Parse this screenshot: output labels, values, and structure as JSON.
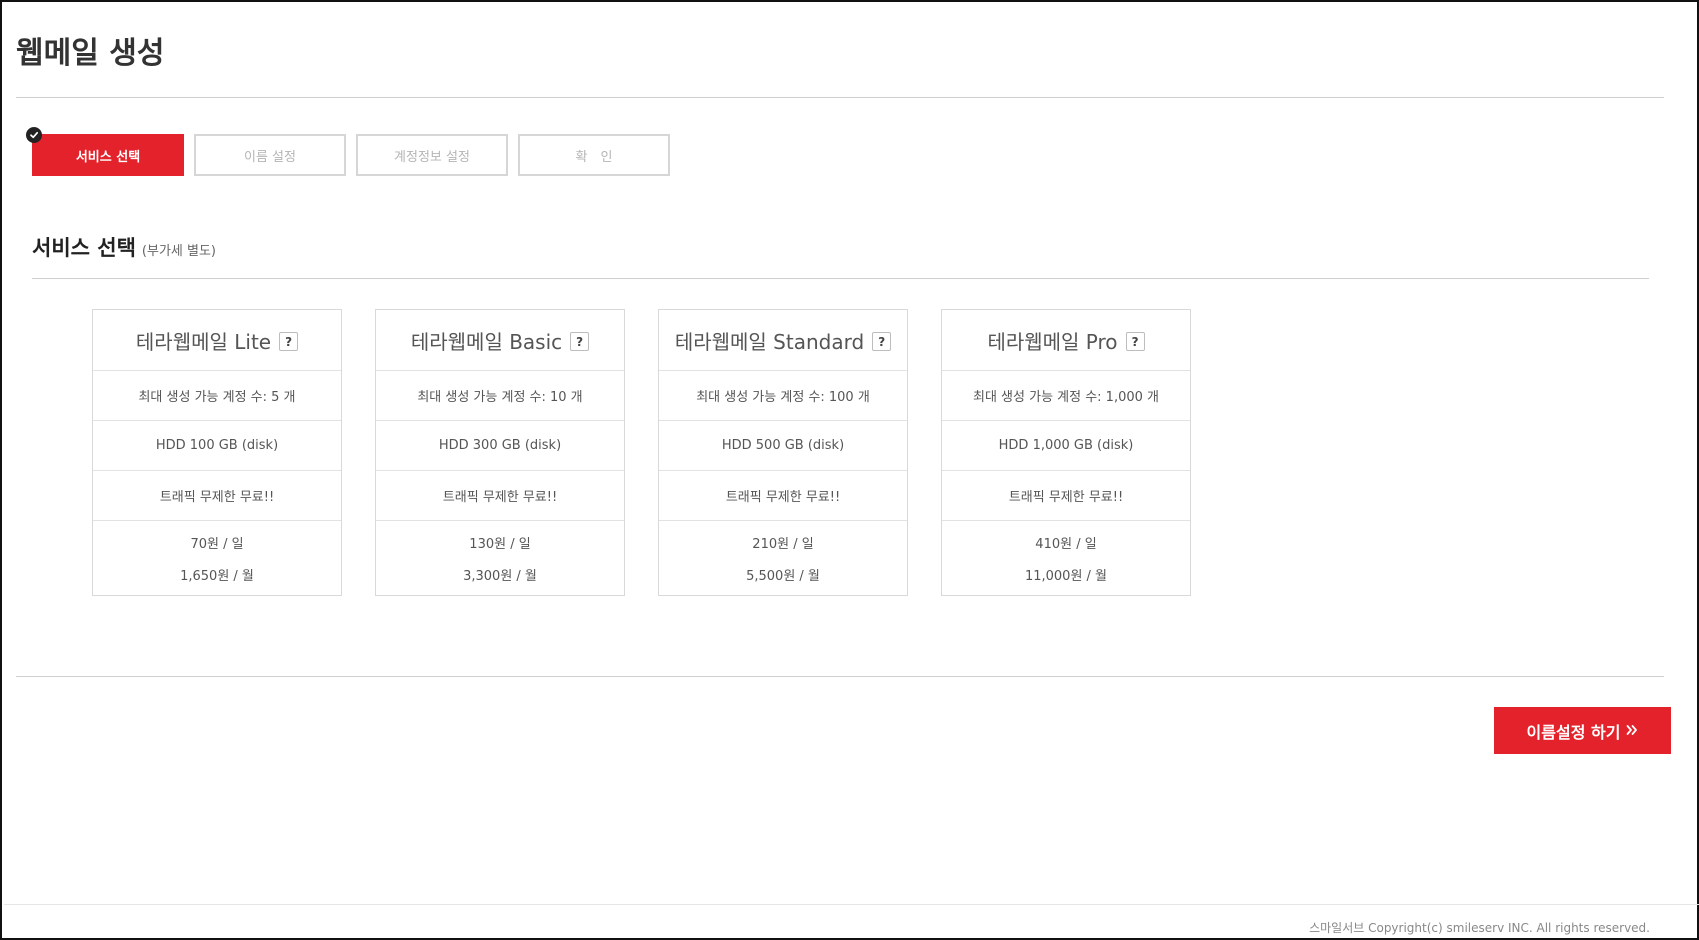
{
  "page": {
    "title": "웹메일 생성"
  },
  "steps": [
    {
      "label": "서비스 선택",
      "active": true
    },
    {
      "label": "이름 설정",
      "active": false
    },
    {
      "label": "계정정보 설정",
      "active": false
    },
    {
      "label": "확　인",
      "active": false
    }
  ],
  "section": {
    "title": "서비스 선택",
    "note": "(부가세 별도)"
  },
  "plans": [
    {
      "name": "테라웹메일 Lite",
      "help": "?",
      "accounts": "최대 생성 가능 계정 수: 5 개",
      "storage": "HDD 100 GB (disk)",
      "traffic": "트래픽 무제한 무료!!",
      "price_day": "70원 / 일",
      "price_month": "1,650원 / 월"
    },
    {
      "name": "테라웹메일 Basic",
      "help": "?",
      "accounts": "최대 생성 가능 계정 수: 10 개",
      "storage": "HDD 300 GB (disk)",
      "traffic": "트래픽 무제한 무료!!",
      "price_day": "130원 / 일",
      "price_month": "3,300원 / 월"
    },
    {
      "name": "테라웹메일 Standard",
      "help": "?",
      "accounts": "최대 생성 가능 계정 수: 100 개",
      "storage": "HDD 500 GB (disk)",
      "traffic": "트래픽 무제한 무료!!",
      "price_day": "210원 / 일",
      "price_month": "5,500원 / 월"
    },
    {
      "name": "테라웹메일 Pro",
      "help": "?",
      "accounts": "최대 생성 가능 계정 수: 1,000 개",
      "storage": "HDD 1,000 GB (disk)",
      "traffic": "트래픽 무제한 무료!!",
      "price_day": "410원 / 일",
      "price_month": "11,000원 / 월"
    }
  ],
  "actions": {
    "next_label": "이름설정 하기"
  },
  "icons": {
    "step_check": "check-circle-icon",
    "next_arrow": "double-chevron-right-icon"
  },
  "colors": {
    "accent": "#e3222b",
    "border": "#d9d9d9",
    "text": "#555555"
  },
  "footer": {
    "copyright": "스마일서브 Copyright(c) smileserv INC. All rights reserved."
  }
}
